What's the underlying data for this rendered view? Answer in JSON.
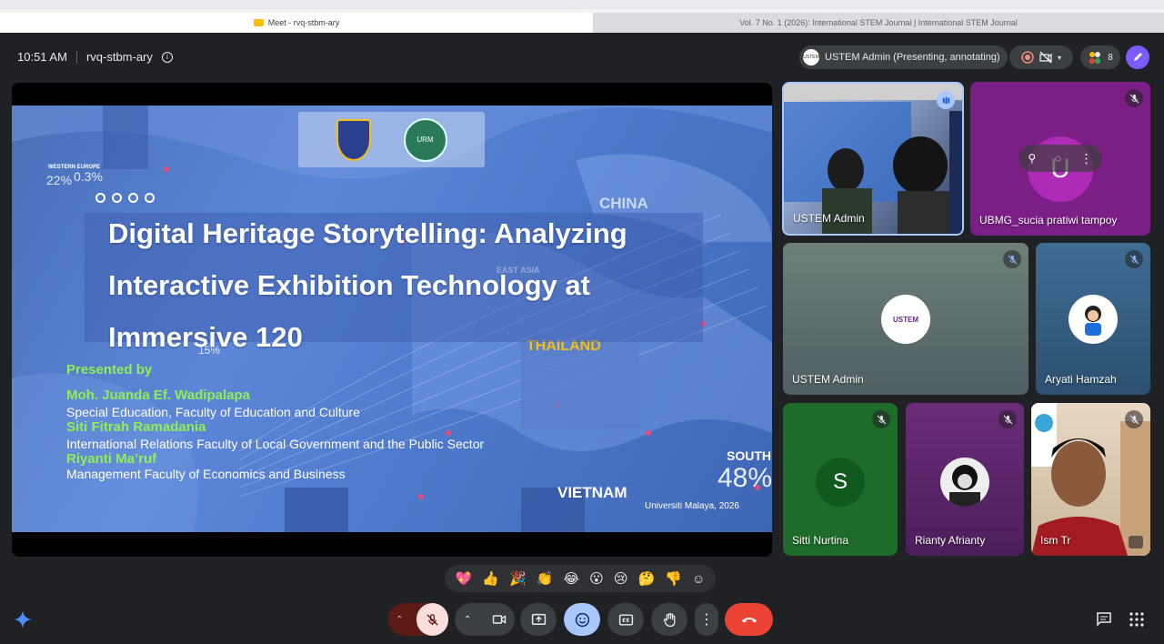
{
  "browser": {
    "tab_active": "Meet - rvq-stbm-ary",
    "tab_inactive": "Vol. 7 No. 1 (2026): International STEM Journal | International STEM Journal"
  },
  "header": {
    "time": "10:51 AM",
    "meeting_code": "rvq-stbm-ary",
    "presenter_label": "USTEM Admin (Presenting, annotating)",
    "participant_count": "8"
  },
  "slide": {
    "title": "Digital Heritage Storytelling: Analyzing Interactive Exhibition Technology at Immersive 120",
    "presented_by": "Presented by",
    "authors": [
      {
        "name": "Moh. Juanda Ef. Wadipalapa",
        "affiliation": "Special Education, Faculty of Education and Culture"
      },
      {
        "name": "Siti Fitrah Ramadania",
        "affiliation": "International Relations Faculty of Local Government and the Public Sector"
      },
      {
        "name": "Riyanti Ma’ruf",
        "affiliation": "Management Faculty of Economics and Business"
      }
    ],
    "footer": "Universiti Malaya, 2026",
    "map_labels": {
      "china": "CHINA",
      "east_asia": "EAST ASIA",
      "thailand": "THAILAND",
      "vietnam": "VIETNAM",
      "south": "SOUTH",
      "south_pct": "48%",
      "pct1": "22%",
      "pct2": "0.3%",
      "western_europe": "WESTERN EUROPE",
      "pct3": "15%"
    }
  },
  "participants": [
    {
      "name": "USTEM Admin",
      "id": "t1"
    },
    {
      "name": "UBMG_sucia pratiwi tampoy",
      "id": "t2",
      "initial": "U"
    },
    {
      "name": "USTEM Admin",
      "id": "t3"
    },
    {
      "name": "Aryati Hamzah",
      "id": "t4"
    },
    {
      "name": "Sitti Nurtina",
      "id": "t5",
      "initial": "S"
    },
    {
      "name": "Rianty Afrianty",
      "id": "t6"
    },
    {
      "name": "Ism Tr",
      "id": "t7"
    }
  ],
  "reactions": [
    "💖",
    "👍",
    "🎉",
    "👏",
    "😂",
    "😮",
    "😢",
    "🤔",
    "👎"
  ],
  "colors": {
    "accent_green": "#8cf055",
    "end_call": "#ea4335",
    "mic_off_bg": "#f9dedc",
    "emoji_active": "#a8c7fa"
  }
}
